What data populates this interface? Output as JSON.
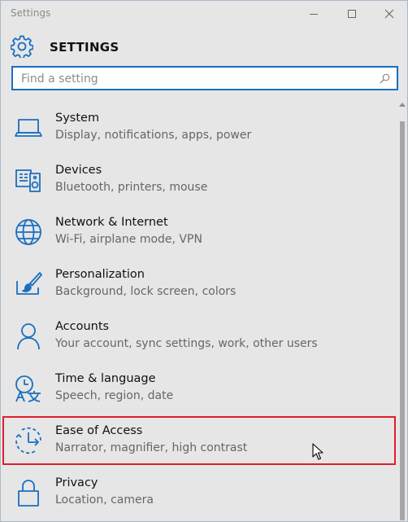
{
  "window": {
    "title": "Settings"
  },
  "header": {
    "title": "SETTINGS"
  },
  "search": {
    "placeholder": "Find a setting"
  },
  "icons": {
    "settings": "gear-icon",
    "search": "search-icon",
    "system": "laptop-icon",
    "devices": "devices-icon",
    "network": "globe-icon",
    "personalization": "paint-brush-icon",
    "accounts": "person-icon",
    "time": "time-language-icon",
    "ease": "ease-of-access-icon",
    "privacy": "lock-icon"
  },
  "colors": {
    "accent": "#1a6fc0",
    "selection_border": "#e01e2d",
    "background": "#e6e6e6"
  },
  "items": [
    {
      "label": "System",
      "desc": "Display, notifications, apps, power"
    },
    {
      "label": "Devices",
      "desc": "Bluetooth, printers, mouse"
    },
    {
      "label": "Network & Internet",
      "desc": "Wi-Fi, airplane mode, VPN"
    },
    {
      "label": "Personalization",
      "desc": "Background, lock screen, colors"
    },
    {
      "label": "Accounts",
      "desc": "Your account, sync settings, work, other users"
    },
    {
      "label": "Time & language",
      "desc": "Speech, region, date"
    },
    {
      "label": "Ease of Access",
      "desc": "Narrator, magnifier, high contrast"
    },
    {
      "label": "Privacy",
      "desc": "Location, camera"
    }
  ]
}
